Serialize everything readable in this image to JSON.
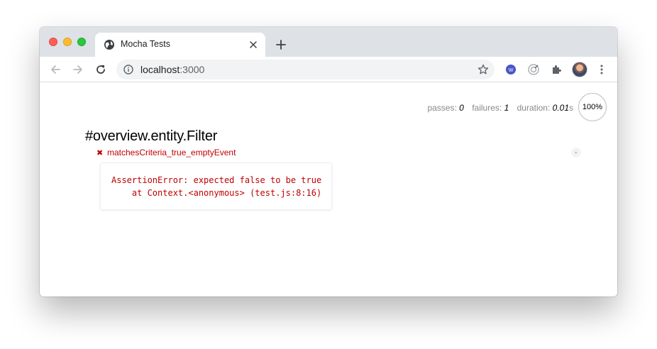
{
  "browser": {
    "tab_title": "Mocha Tests",
    "url_host": "localhost",
    "url_port": ":3000",
    "icons": [
      "globe-icon",
      "close-icon",
      "plus-icon",
      "back-arrow-icon",
      "forward-arrow-icon",
      "reload-icon",
      "info-icon",
      "star-icon",
      "extension-icon",
      "puzzle-icon",
      "kebab-menu-icon"
    ]
  },
  "stats": {
    "passes_label": "passes:",
    "passes_value": "0",
    "failures_label": "failures:",
    "failures_value": "1",
    "duration_label": "duration:",
    "duration_value": "0.01",
    "duration_unit": "s",
    "progress_text": "100%"
  },
  "report": {
    "suite_title": "#overview.entity.Filter",
    "test_mark": "✖",
    "test_title": "matchesCriteria_true_emptyEvent",
    "replay_symbol": "‣",
    "error_line1": "AssertionError: expected false to be true",
    "error_line2": "    at Context.<anonymous> (test.js:8:16)"
  },
  "colors": {
    "failure": "#c00000",
    "chrome_bg": "#dee1e6",
    "omnibox_bg": "#f1f3f4"
  }
}
